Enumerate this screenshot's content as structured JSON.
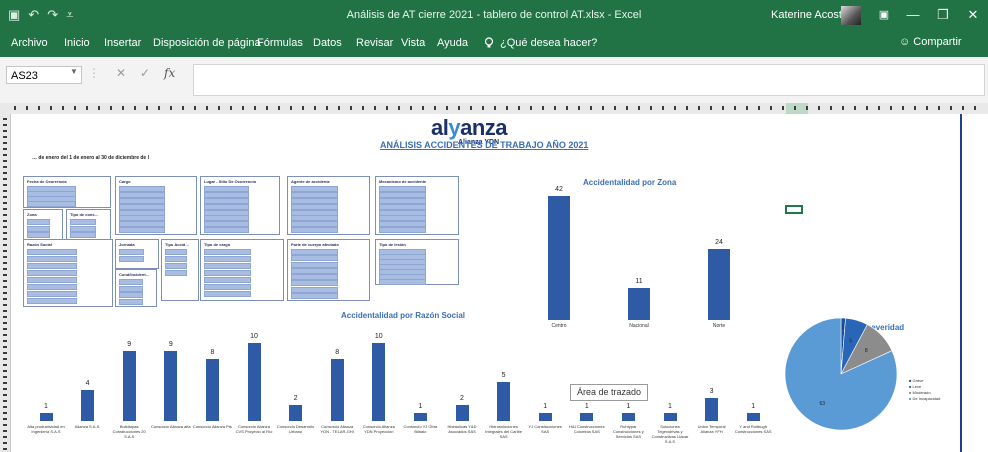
{
  "app": {
    "title": "Análisis de AT cierre 2021 - tablero de control AT.xlsx  -  Excel",
    "user": "Katerine Acosta",
    "qat": [
      "▣",
      "↶",
      "↷",
      "⩡"
    ],
    "window_buttons": [
      "▣",
      "—",
      "❐",
      "✕"
    ]
  },
  "menu": {
    "items": [
      "Archivo",
      "Inicio",
      "Insertar",
      "Disposición de página",
      "Fórmulas",
      "Datos",
      "Revisar",
      "Vista",
      "Ayuda"
    ],
    "tell_me": "¿Qué desea hacer?",
    "share": "Compartir"
  },
  "formula_bar": {
    "name_box": "AS23",
    "cancel_icon": "✕",
    "enter_icon": "✓",
    "fx": "fx",
    "value": ""
  },
  "dashboard": {
    "logo_left": "al",
    "logo_y": "y",
    "logo_right": "anza",
    "logo_sub": "Alianza YDN",
    "title": "ANÁLISIS ACCIDENTES DE TRABAJO AÑO 2021",
    "date_range": "… de enero del 1 de enero al 30 de diciembre de l"
  },
  "tooltip": "Área de trazado",
  "chart_data": [
    {
      "type": "bar",
      "title": "Accidentalidad por Zona",
      "categories": [
        "Centro",
        "Nacional",
        "Norte"
      ],
      "values": [
        42,
        11,
        24
      ],
      "ylim": [
        0,
        42
      ]
    },
    {
      "type": "bar",
      "title": "Accidentalidad por Razón Social",
      "categories": [
        "Alta productividad en Ingeniería S.A.S",
        "Alianza S.A.S.",
        "Buildtopas Construcciones 20 S.A.S",
        "Consorcio Alianza alta",
        "Consorcio Alianza Pts",
        "Consorcio Alianza CVS Proyecto al Río",
        "Consorcio Desarrollo Urbano",
        "Consorcio Alianza YDN - TELAR-GHI",
        "Consorcio Alianza YDN Proyección",
        "Consorcio YJ Obra Bilbalo",
        "Hidráulicas Y&D Asociados SAS",
        "Hidrosoluciones Integrales del Caribe SAS",
        "YJ Construcciones SAS",
        "H&I Construcciones Colombia SAS",
        "Ruhtypar Construcciones y Servicios SAS",
        "Soluciones Tegevidrivas y Constructivas Ltaoar S.A.S",
        "Unión Temporal Alianza YFH",
        "Y and Ruitbugh Construcciones SAS"
      ],
      "values": [
        1,
        4,
        9,
        9,
        8,
        10,
        2,
        8,
        10,
        1,
        2,
        5,
        1,
        1,
        1,
        1,
        3,
        1
      ],
      "ylim": [
        0,
        10
      ]
    },
    {
      "type": "pie",
      "title": "Carácter por severidad",
      "series": [
        {
          "name": "Grave",
          "value": 1,
          "color": "#1e4f9c"
        },
        {
          "name": "Leve",
          "value": 5,
          "color": "#2a66b8"
        },
        {
          "name": "Moderado",
          "value": 8,
          "color": "#8c8c8c"
        },
        {
          "name": "De Incapacidad",
          "value": 63,
          "color": "#5b9bd5"
        }
      ],
      "data_labels": [
        "1",
        "5",
        "8",
        "63"
      ],
      "legend_position": "right"
    }
  ],
  "slicers": [
    {
      "title": "Fecha de Ocurrencia",
      "items": 4
    },
    {
      "title": "Cargo",
      "items": 8
    },
    {
      "title": "Lugar - Sitio De Ocurrencia",
      "items": 8
    },
    {
      "title": "Agente de accidente",
      "items": 8
    },
    {
      "title": "Mecanismo de accidente",
      "items": 8
    },
    {
      "title": "Zona",
      "items": 3
    },
    {
      "title": "Tipo de cons…",
      "items": 3
    },
    {
      "title": "Razón Social",
      "items": 8
    },
    {
      "title": "Jornada",
      "items": 2
    },
    {
      "title": "Tipo Accid…",
      "items": 4
    },
    {
      "title": "Tipo de cargo",
      "items": 7
    },
    {
      "title": "Parte de cuerpo afectado",
      "items": 8
    },
    {
      "title": "Tipo de lesión",
      "items": 7
    },
    {
      "title": "Cond/Incident…",
      "items": 4
    }
  ]
}
